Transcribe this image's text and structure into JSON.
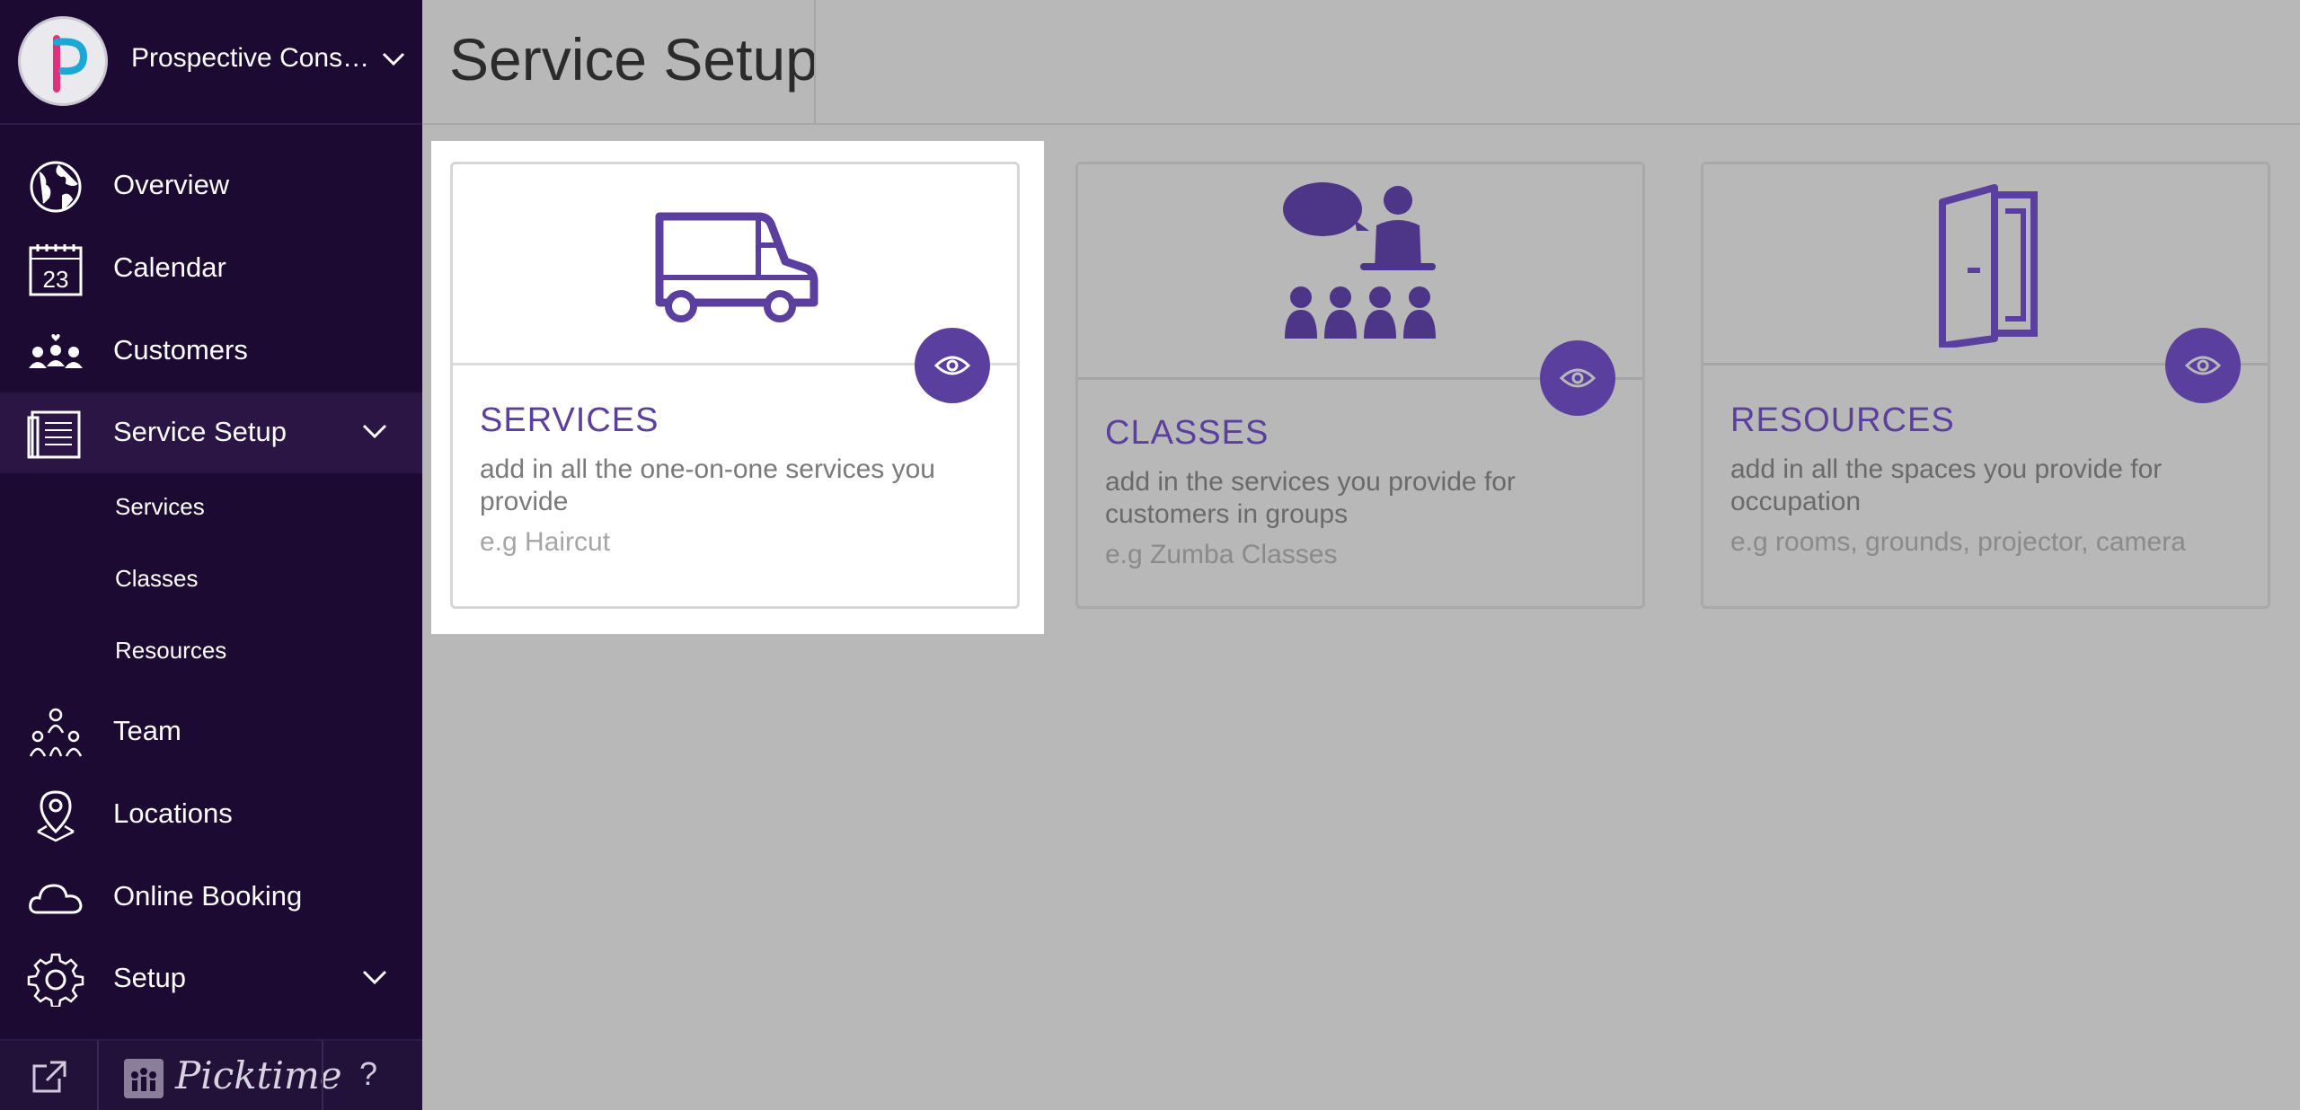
{
  "sidebar": {
    "business_name": "Prospective Consul…",
    "nav": [
      {
        "label": "Overview",
        "icon": "globe-icon"
      },
      {
        "label": "Calendar",
        "icon": "calendar-icon",
        "icon_text": "23"
      },
      {
        "label": "Customers",
        "icon": "customers-icon"
      },
      {
        "label": "Service Setup",
        "icon": "service-list-icon"
      },
      {
        "label": "Team",
        "icon": "team-icon"
      },
      {
        "label": "Locations",
        "icon": "location-pin-icon"
      },
      {
        "label": "Online Booking",
        "icon": "cloud-icon"
      },
      {
        "label": "Setup",
        "icon": "gear-icon"
      }
    ],
    "sub_items": [
      "Services",
      "Classes",
      "Resources"
    ],
    "footer": {
      "brand": "Picktime",
      "help": "?"
    }
  },
  "header": {
    "title": "Service Setup"
  },
  "cards": [
    {
      "title": "SERVICES",
      "description": "add in all the one-on-one services you provide",
      "example": "e.g Haircut",
      "icon": "van-icon"
    },
    {
      "title": "CLASSES",
      "description": "add in the services you provide for customers in groups",
      "example": "e.g Zumba Classes",
      "icon": "class-group-icon"
    },
    {
      "title": "RESOURCES",
      "description": "add in all the spaces you provide for occupation",
      "example": "e.g rooms, grounds, projector, camera",
      "icon": "door-icon"
    }
  ],
  "colors": {
    "sidebar_bg": "#1c0a33",
    "accent": "#5a3f9e",
    "overlay": "#b8b8b8"
  }
}
